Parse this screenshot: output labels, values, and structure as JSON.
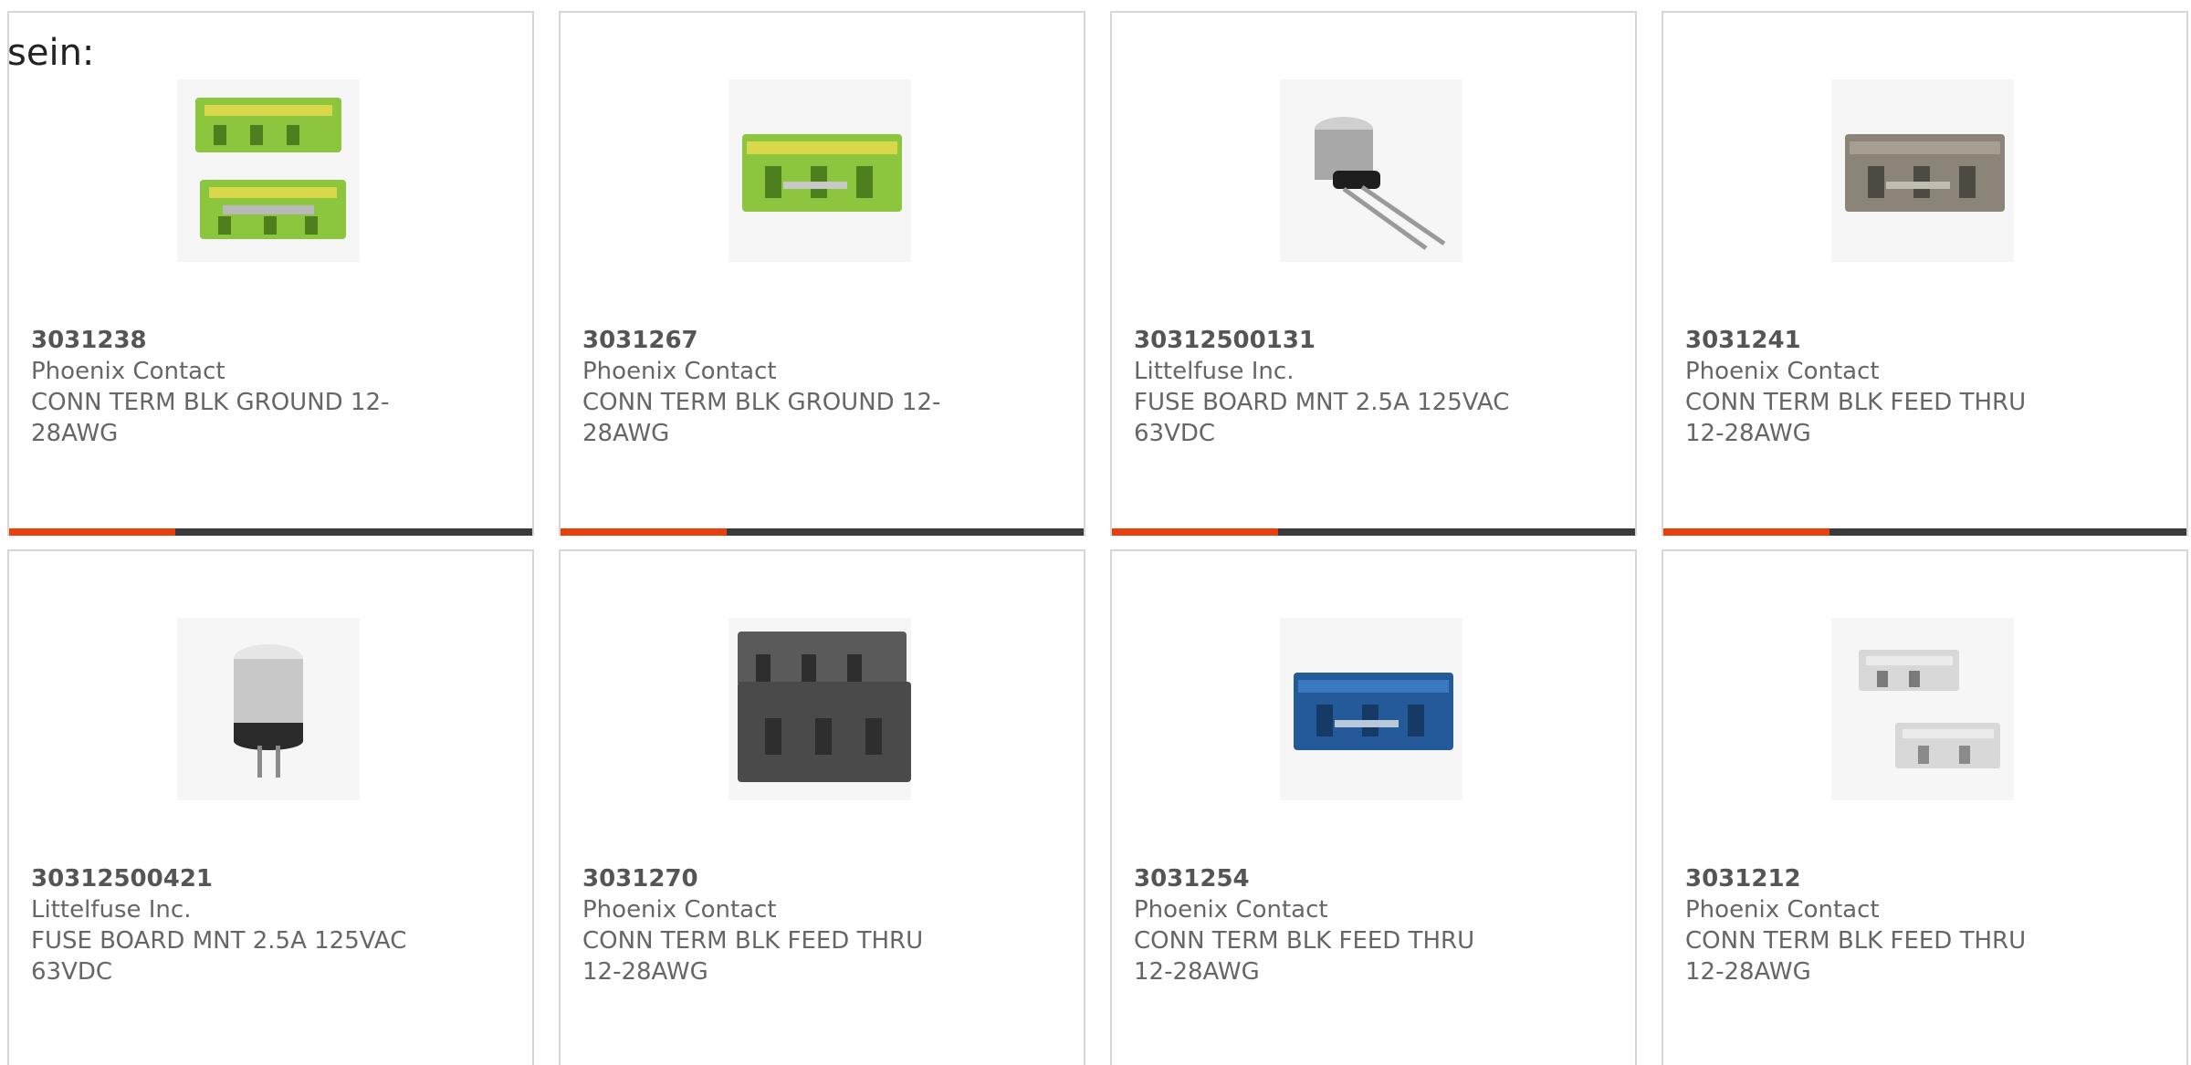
{
  "intro_text": "sein:",
  "accent_color": "#e8400c",
  "bar_color": "#3a3a3a",
  "products": [
    {
      "part_number": "3031238",
      "manufacturer": "Phoenix Contact",
      "description": "CONN TERM BLK GROUND 12-28AWG",
      "image": "terminal-block-ground-pair"
    },
    {
      "part_number": "3031267",
      "manufacturer": "Phoenix Contact",
      "description": "CONN TERM BLK GROUND 12-28AWG",
      "image": "terminal-block-ground"
    },
    {
      "part_number": "30312500131",
      "manufacturer": "Littelfuse Inc.",
      "description": "FUSE BOARD MNT 2.5A 125VAC 63VDC",
      "image": "radial-fuse-leads"
    },
    {
      "part_number": "3031241",
      "manufacturer": "Phoenix Contact",
      "description": "CONN TERM BLK FEED THRU 12-28AWG",
      "image": "terminal-block-gray"
    },
    {
      "part_number": "30312500421",
      "manufacturer": "Littelfuse Inc.",
      "description": "FUSE BOARD MNT 2.5A 125VAC 63VDC",
      "image": "radial-fuse-short"
    },
    {
      "part_number": "3031270",
      "manufacturer": "Phoenix Contact",
      "description": "CONN TERM BLK FEED THRU 12-28AWG",
      "image": "terminal-block-dark-double"
    },
    {
      "part_number": "3031254",
      "manufacturer": "Phoenix Contact",
      "description": "CONN TERM BLK FEED THRU 12-28AWG",
      "image": "terminal-block-blue"
    },
    {
      "part_number": "3031212",
      "manufacturer": "Phoenix Contact",
      "description": "CONN TERM BLK FEED THRU 12-28AWG",
      "image": "terminal-block-light-pair"
    }
  ]
}
